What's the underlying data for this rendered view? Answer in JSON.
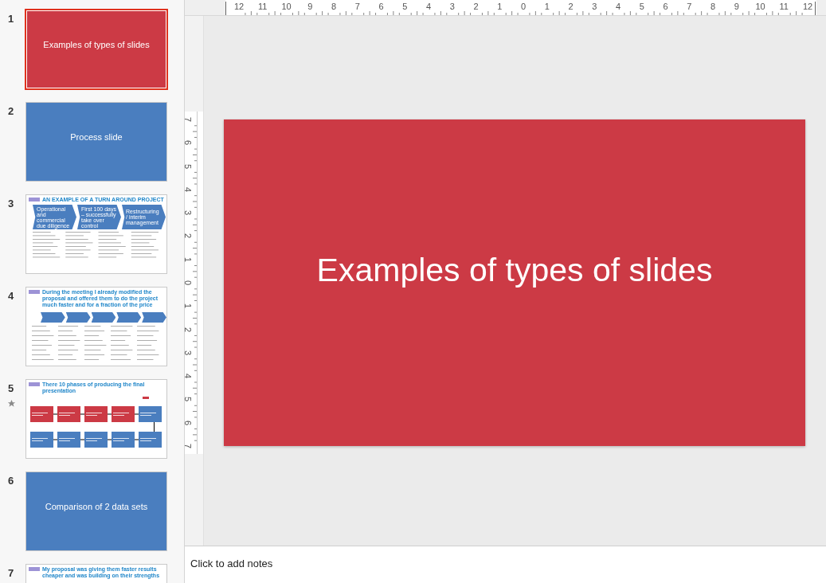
{
  "slides_panel": {
    "slides": [
      {
        "number": "1",
        "selected": true,
        "starred": false,
        "kind": "section",
        "color": "#cc3a45",
        "title": "Examples of types of slides"
      },
      {
        "number": "2",
        "selected": false,
        "starred": false,
        "kind": "section",
        "color": "#4a7ebf",
        "title": "Process slide"
      },
      {
        "number": "3",
        "selected": false,
        "starred": false,
        "kind": "process",
        "title": "AN EXAMPLE OF A TURN AROUND PROJECT",
        "steps": [
          "Operational and commercial due diligence",
          "First 100 days – successfully take over control",
          "Restructuring / interim management"
        ]
      },
      {
        "number": "4",
        "selected": false,
        "starred": false,
        "kind": "chevrons",
        "title": "During the meeting I already modified the proposal and offered them to do the project much faster and for a fraction of the price"
      },
      {
        "number": "5",
        "selected": false,
        "starred": true,
        "kind": "flow",
        "title": "There 10 phases of producing the final presentation"
      },
      {
        "number": "6",
        "selected": false,
        "starred": false,
        "kind": "section",
        "color": "#4a7ebf",
        "title": "Comparison of 2 data sets"
      },
      {
        "number": "7",
        "selected": false,
        "starred": false,
        "kind": "text",
        "title": "My proposal was giving them faster results cheaper and was building on their strengths"
      }
    ]
  },
  "rulers": {
    "horizontal": [
      "12",
      "11",
      "10",
      "9",
      "8",
      "7",
      "6",
      "5",
      "4",
      "3",
      "2",
      "1",
      "0",
      "1",
      "2",
      "3",
      "4",
      "5",
      "6",
      "7",
      "8",
      "9",
      "10",
      "11",
      "12"
    ],
    "vertical": [
      "7",
      "6",
      "5",
      "4",
      "3",
      "2",
      "1",
      "0",
      "1",
      "2",
      "3",
      "4",
      "5",
      "6",
      "7"
    ]
  },
  "slide": {
    "color": "#cc3a45",
    "title": "Examples of types of slides"
  },
  "notes": {
    "prompt": "Click to add notes"
  }
}
